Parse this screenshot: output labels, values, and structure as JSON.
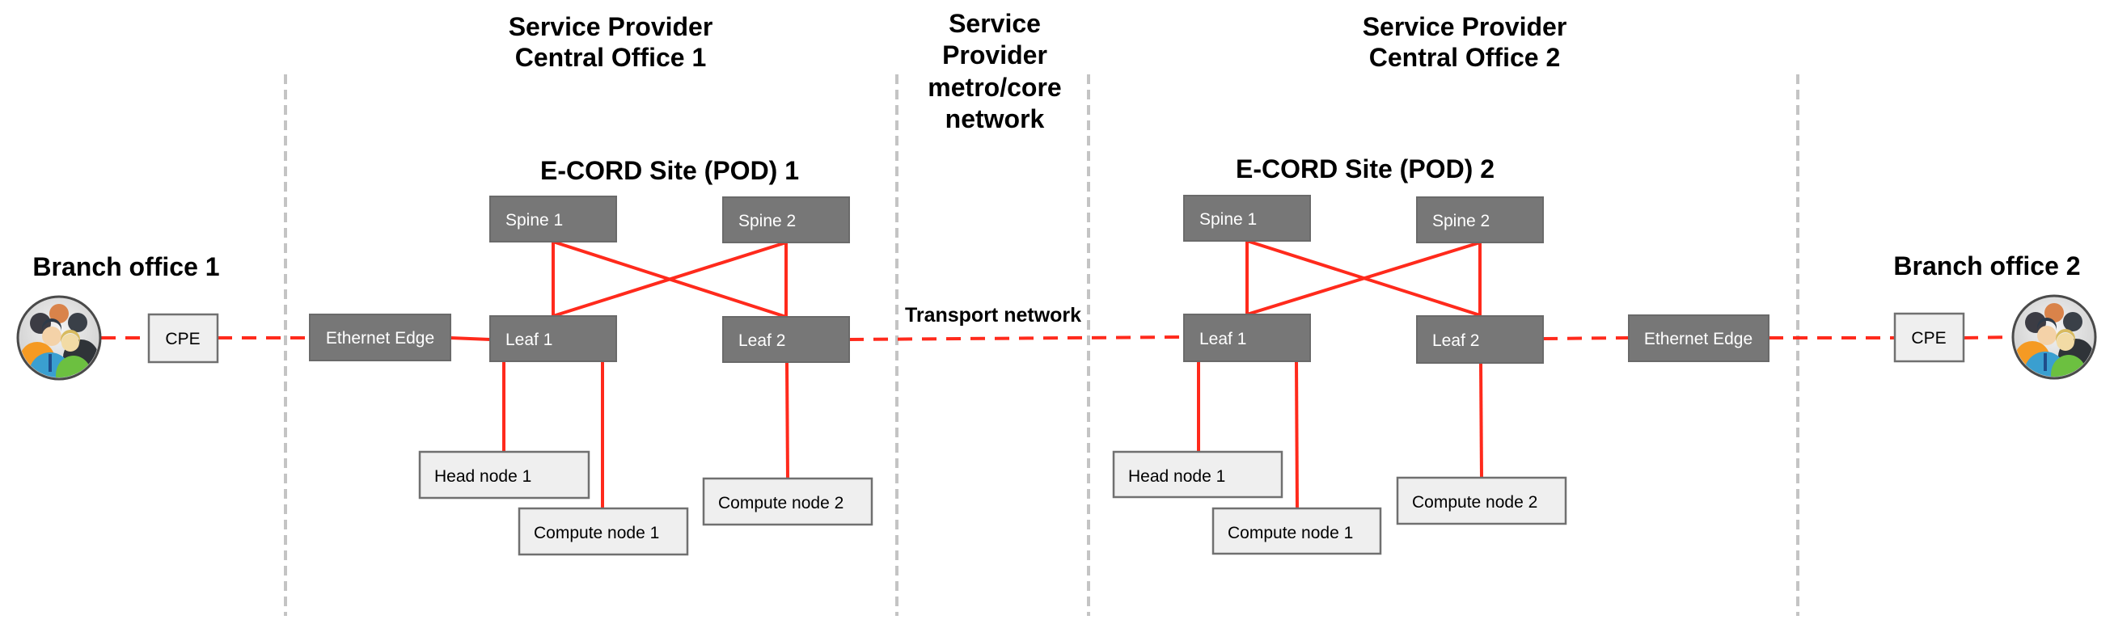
{
  "regions": {
    "co1": {
      "line1": "Service Provider",
      "line2": "Central Office 1"
    },
    "metro": {
      "line1": "Service",
      "line2": "Provider",
      "line3": "metro/core",
      "line4": "network"
    },
    "co2": {
      "line1": "Service Provider",
      "line2": "Central Office 2"
    }
  },
  "branches": {
    "left": {
      "title": "Branch office 1",
      "avatar_icon": "user-group-icon",
      "cpe": "CPE"
    },
    "right": {
      "title": "Branch office 2",
      "avatar_icon": "user-group-icon",
      "cpe": "CPE"
    }
  },
  "pods": [
    {
      "title": "E-CORD Site (POD) 1",
      "ethernet_edge": "Ethernet Edge",
      "spine1": "Spine 1",
      "spine2": "Spine 2",
      "leaf1": "Leaf 1",
      "leaf2": "Leaf 2",
      "head_node": "Head node 1",
      "compute_node_1": "Compute node 1",
      "compute_node_2": "Compute node 2"
    },
    {
      "title": "E-CORD Site (POD) 2",
      "ethernet_edge": "Ethernet Edge",
      "spine1": "Spine 1",
      "spine2": "Spine 2",
      "leaf1": "Leaf 1",
      "leaf2": "Leaf 2",
      "head_node": "Head node 1",
      "compute_node_1": "Compute node 1",
      "compute_node_2": "Compute node 2"
    }
  ],
  "transport_label": "Transport network",
  "colors": {
    "link": "#ff2a1c",
    "switch_fill": "#777777",
    "server_fill": "#efefef",
    "divider": "#c4c4c4"
  }
}
